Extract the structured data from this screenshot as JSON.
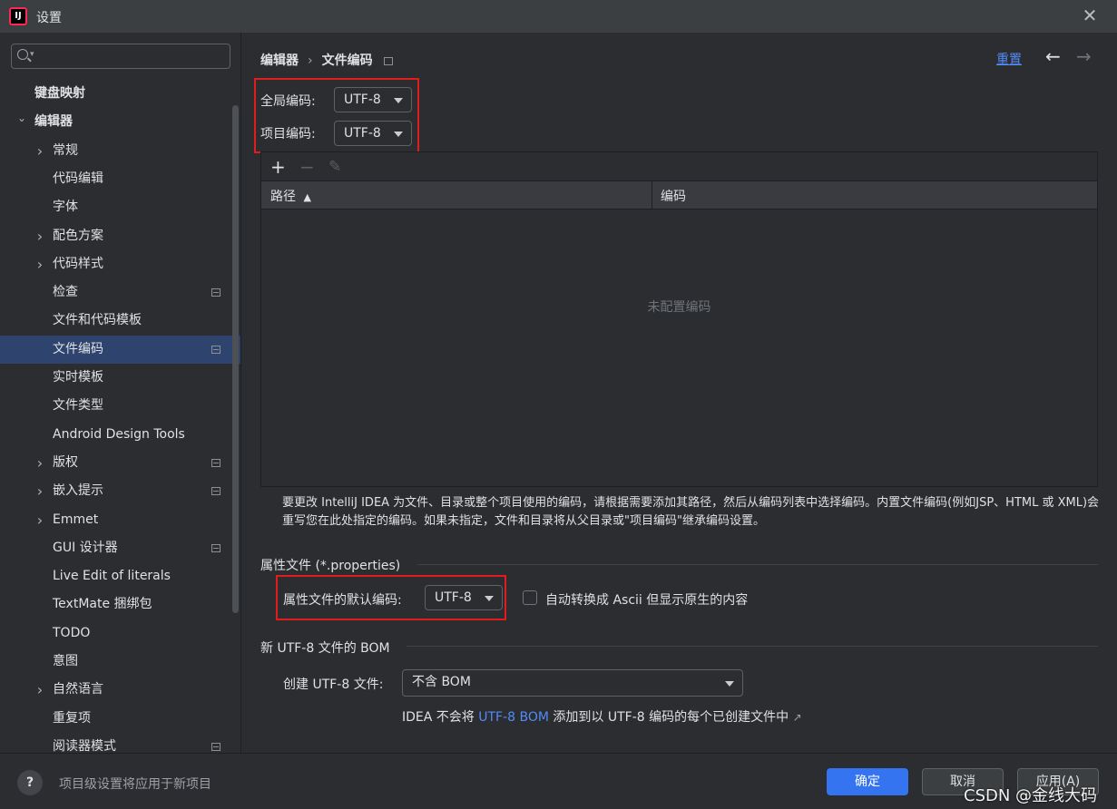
{
  "window": {
    "app_icon": "IJ",
    "title": "设置",
    "close": "✕"
  },
  "sidebar": {
    "search_placeholder": "",
    "items": [
      {
        "label": "键盘映射",
        "bold": true
      },
      {
        "label": "编辑器",
        "bold": true,
        "expanded": true
      },
      {
        "label": "常规",
        "chevron": true
      },
      {
        "label": "代码编辑"
      },
      {
        "label": "字体"
      },
      {
        "label": "配色方案",
        "chevron": true
      },
      {
        "label": "代码样式",
        "chevron": true
      },
      {
        "label": "检查",
        "page_icon": true
      },
      {
        "label": "文件和代码模板"
      },
      {
        "label": "文件编码",
        "page_icon": true,
        "selected": true
      },
      {
        "label": "实时模板"
      },
      {
        "label": "文件类型"
      },
      {
        "label": "Android Design Tools"
      },
      {
        "label": "版权",
        "chevron": true,
        "page_icon": true
      },
      {
        "label": "嵌入提示",
        "chevron": true,
        "page_icon": true
      },
      {
        "label": "Emmet",
        "chevron": true
      },
      {
        "label": "GUI 设计器",
        "page_icon": true
      },
      {
        "label": "Live Edit of literals"
      },
      {
        "label": "TextMate 捆绑包"
      },
      {
        "label": "TODO"
      },
      {
        "label": "意图"
      },
      {
        "label": "自然语言",
        "chevron": true
      },
      {
        "label": "重复项"
      },
      {
        "label": "阅读器模式",
        "page_icon": true
      }
    ]
  },
  "breadcrumb": {
    "parent": "编辑器",
    "separator": "›",
    "current": "文件编码"
  },
  "header_actions": {
    "reset": "重置",
    "back": "←",
    "forward": "→"
  },
  "encoding": {
    "global_label": "全局编码:",
    "global_value": "UTF-8",
    "project_label": "项目编码:",
    "project_value": "UTF-8"
  },
  "table": {
    "toolbar": {
      "add": "+",
      "remove": "−",
      "edit": "✎"
    },
    "columns": [
      "路径",
      "编码"
    ],
    "sort_indicator": "▲",
    "empty_text": "未配置编码"
  },
  "help_text": {
    "line1": "要更改 IntelliJ IDEA 为文件、目录或整个项目使用的编码，请根据需要添加其路径，然后从编码列表中选择编码。内置文件编码(例如JSP、HTML 或 XML)会",
    "line2": "重写您在此处指定的编码。如果未指定，文件和目录将从父目录或\"项目编码\"继承编码设置。"
  },
  "properties": {
    "section_title": "属性文件 (*.properties)",
    "default_label": "属性文件的默认编码:",
    "default_value": "UTF-8",
    "ascii_checkbox_label": "自动转换成 Ascii 但显示原生的内容",
    "ascii_checked": false
  },
  "bom": {
    "section_title": "新 UTF-8 文件的 BOM",
    "create_label": "创建 UTF-8 文件:",
    "create_value": "不含 BOM",
    "note_prefix": "IDEA 不会将",
    "note_link": "UTF-8 BOM",
    "note_suffix": "添加到以 UTF-8 编码的每个已创建文件中",
    "note_arrow": "↗"
  },
  "footer": {
    "help": "?",
    "note": "项目级设置将应用于新项目",
    "ok": "确定",
    "cancel": "取消",
    "apply": "应用(A)",
    "watermark": "CSDN @金线大码"
  },
  "colors": {
    "background": "#2b2d30",
    "selection": "#2e436e",
    "accent": "#3574f0",
    "link": "#548af7",
    "highlight_box": "#e21c1c"
  }
}
